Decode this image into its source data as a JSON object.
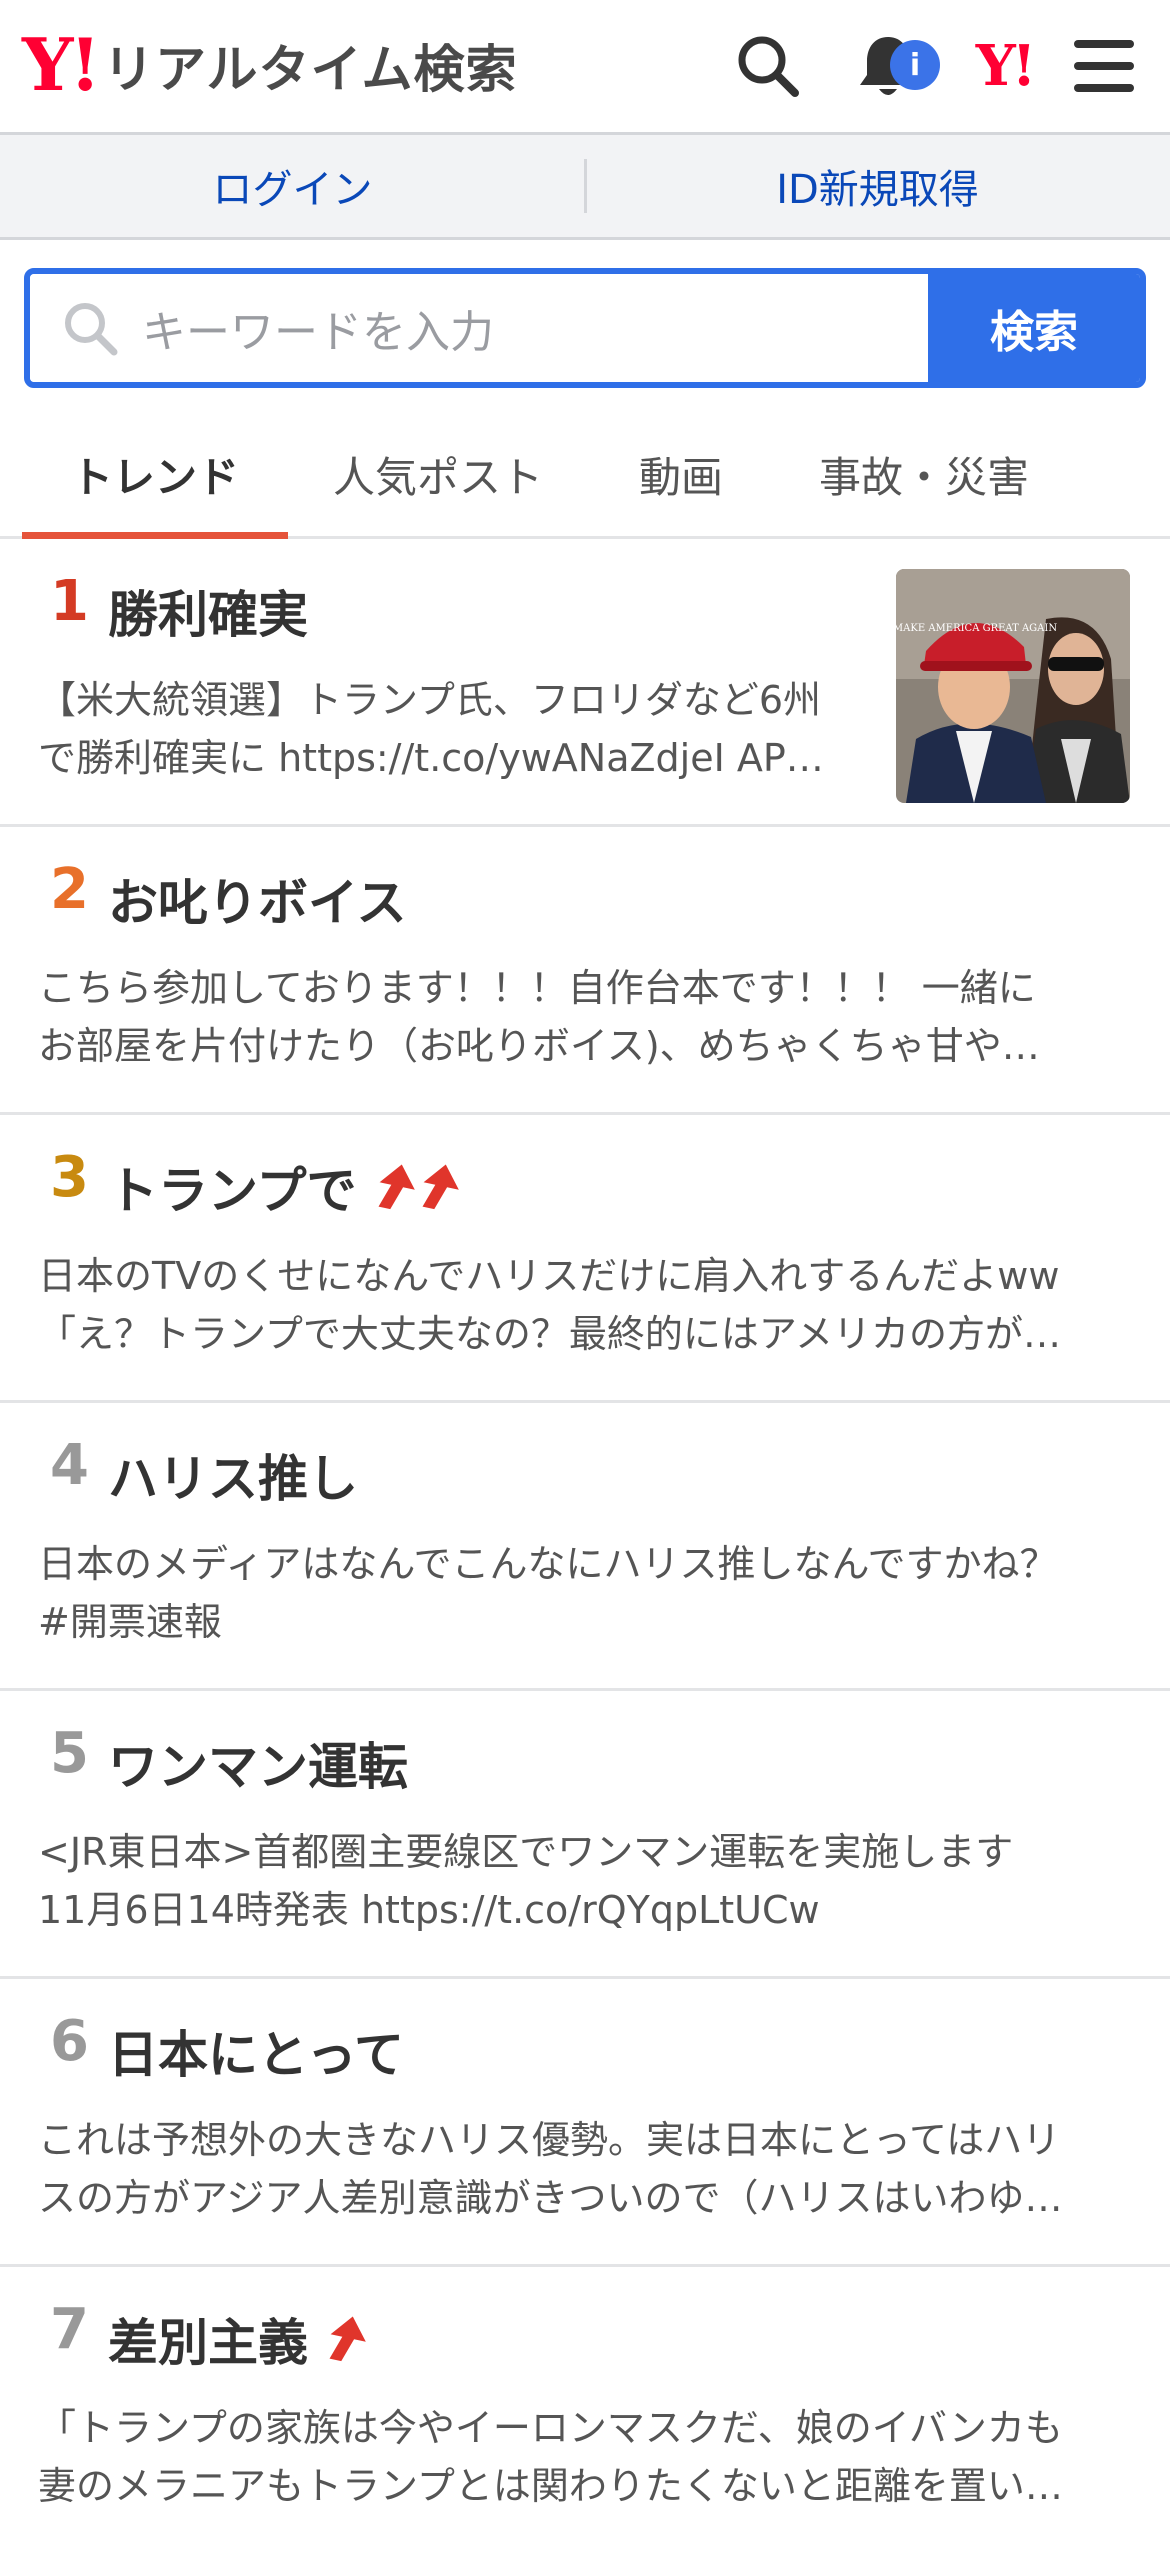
{
  "header": {
    "logo_mark": "Y!",
    "logo_text": "リアルタイム検索",
    "notification_badge": "i",
    "yahoo_mark": "Y!"
  },
  "auth": {
    "login": "ログイン",
    "signup": "ID新規取得"
  },
  "search": {
    "placeholder": "キーワードを入力",
    "button": "検索"
  },
  "tabs": [
    {
      "label": "トレンド",
      "active": true
    },
    {
      "label": "人気ポスト",
      "active": false
    },
    {
      "label": "動画",
      "active": false
    },
    {
      "label": "事故・災害",
      "active": false
    }
  ],
  "colors": {
    "brand_red": "#ff0033",
    "accent_blue": "#2f6fe8",
    "rank_1": "#d43b24",
    "rank_2": "#e8702a",
    "rank_3": "#c88a10",
    "rank_other": "#999999",
    "trend_arrow": "#e0352b"
  },
  "trends": [
    {
      "rank": "1",
      "title": "勝利確実",
      "arrows": 0,
      "line1": "【米大統領選】トランプ氏、フロリダなど6州",
      "line2": "で勝利確実に https://t.co/ywANaZdjeI AP…",
      "thumbnail_hat_text": "MAKE AMERICA GREAT AGAIN"
    },
    {
      "rank": "2",
      "title": "お叱りボイス",
      "arrows": 0,
      "line1": "こちら参加しております！！！自作台本です！！！ 一緒に",
      "line2": "お部屋を片付けたり（お叱りボイス)、めちゃくちゃ甘や…"
    },
    {
      "rank": "3",
      "title": "トランプで",
      "arrows": 2,
      "line1": "日本のTVのくせになんでハリスだけに肩入れするんだよww",
      "line2": "「え？トランプで大丈夫なの？最終的にはアメリカの方が…"
    },
    {
      "rank": "4",
      "title": "ハリス推し",
      "arrows": 0,
      "line1": "日本のメディアはなんでこんなにハリス推しなんですかね？",
      "line2": "#開票速報"
    },
    {
      "rank": "5",
      "title": "ワンマン運転",
      "arrows": 0,
      "line1": "<JR東日本>首都圏主要線区でワンマン運転を実施します",
      "line2": "11月6日14時発表 https://t.co/rQYqpLtUCw"
    },
    {
      "rank": "6",
      "title": "日本にとって",
      "arrows": 0,
      "line1": "これは予想外の大きなハリス優勢。実は日本にとってはハリ",
      "line2": "スの方がアジア人差別意識がきついので（ハリスはいわゆ…"
    },
    {
      "rank": "7",
      "title": "差別主義",
      "arrows": 1,
      "line1": "「トランプの家族は今やイーロンマスクだ、娘のイバンカも",
      "line2": "妻のメラニアもトランプとは関わりたくないと距離を置い…"
    }
  ]
}
